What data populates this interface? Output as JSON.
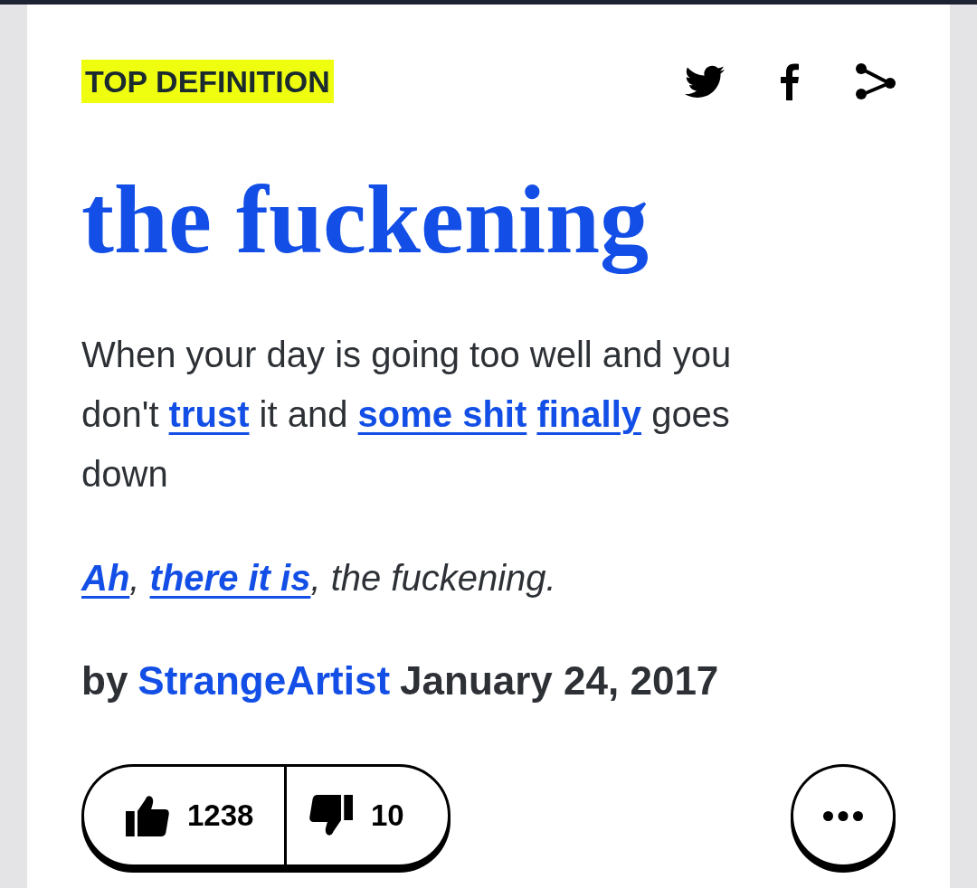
{
  "badge": "TOP DEFINITION",
  "word": "the fuckening",
  "meaning": "When your day is going too well and you don't **trust** it and **some shit** **finally** goes down",
  "example": "**Ah**, **there it is**, the fuckening.",
  "author": {
    "prefix": "by",
    "name": "StrangeArtist",
    "date": "January 24, 2017"
  },
  "votes": {
    "up": "1238",
    "down": "10"
  }
}
